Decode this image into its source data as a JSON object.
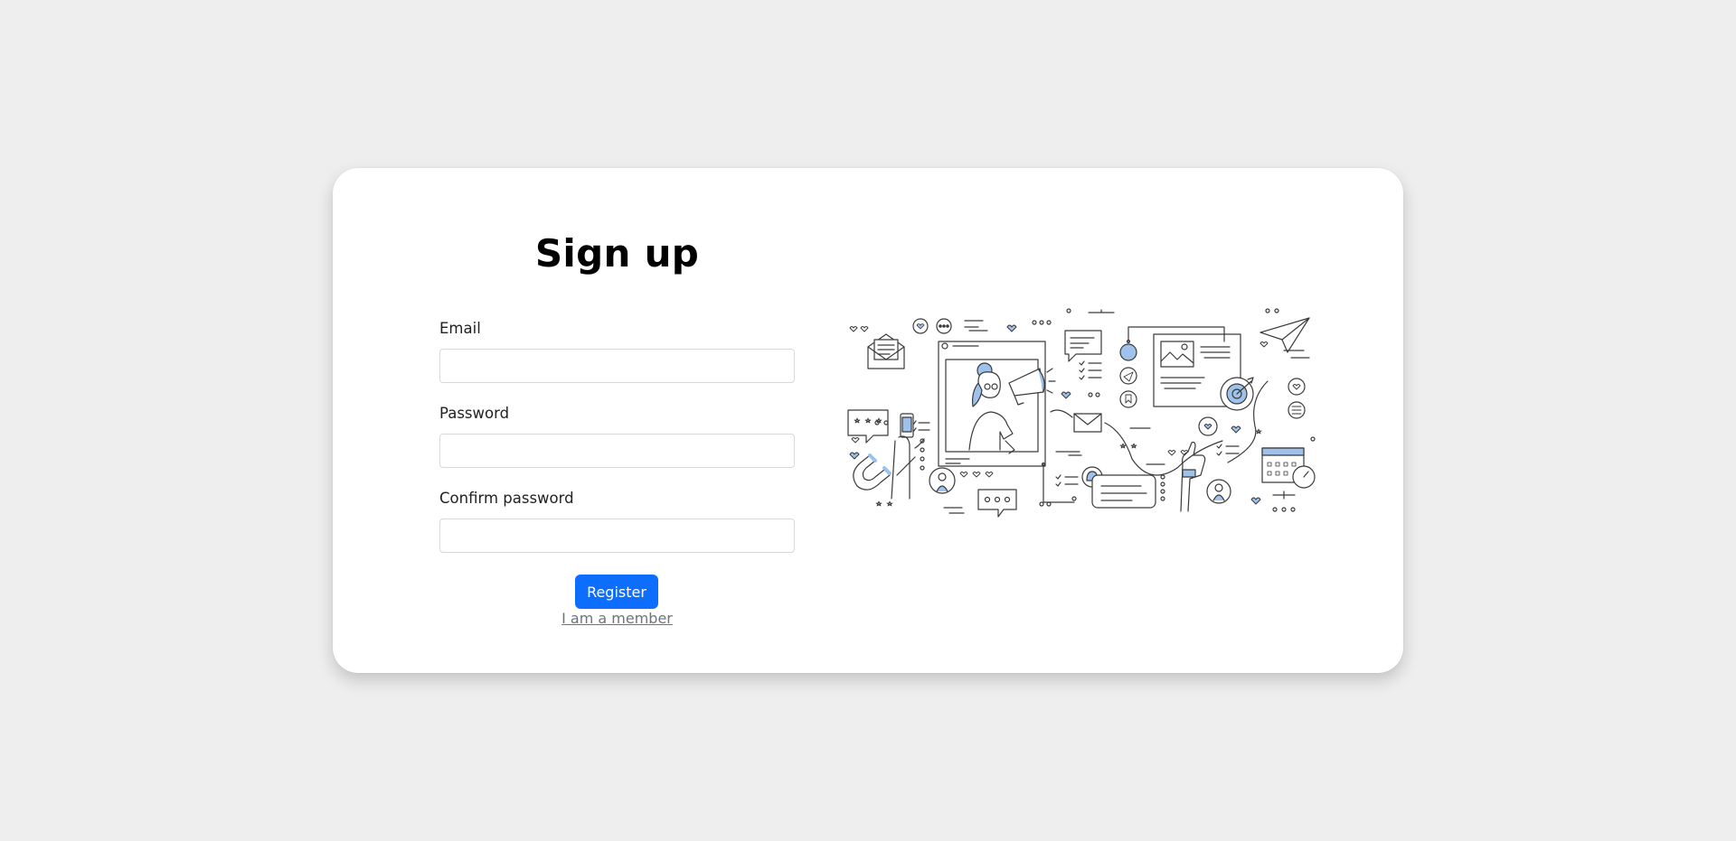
{
  "form": {
    "title": "Sign up",
    "email_label": "Email",
    "email_value": "",
    "password_label": "Password",
    "password_value": "",
    "confirm_label": "Confirm password",
    "confirm_value": "",
    "register_label": "Register",
    "member_link": "I am a member"
  },
  "illustration": {
    "icon": "marketing-illustration",
    "accent_color": "#9ec2ec",
    "line_color": "#3a3a3a"
  },
  "colors": {
    "background": "#eeeeee",
    "card": "#ffffff",
    "primary": "#0d6efd",
    "link": "#6c757d"
  }
}
